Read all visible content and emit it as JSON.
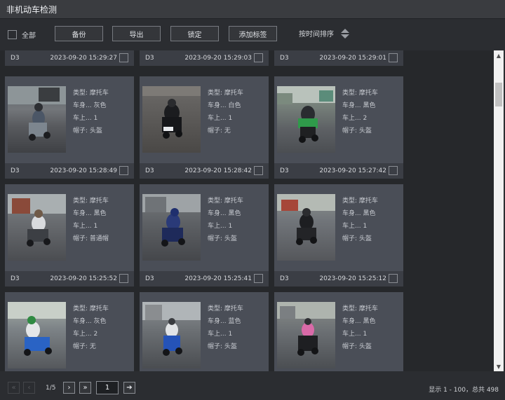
{
  "window": {
    "title": "非机动车检测"
  },
  "toolbar": {
    "select_all_label": "全部",
    "backup_label": "备份",
    "export_label": "导出",
    "lock_label": "锁定",
    "add_tag_label": "添加标签",
    "sort_label": "按时间排序"
  },
  "attr_labels": {
    "type": "类型:",
    "body": "车身...",
    "riders": "车上...",
    "helmet": "帽子:"
  },
  "top_row": [
    {
      "camera": "D3",
      "time": "2023-09-20 15:29:27"
    },
    {
      "camera": "D3",
      "time": "2023-09-20 15:29:03"
    },
    {
      "camera": "D3",
      "time": "2023-09-20 15:29:01"
    }
  ],
  "cards": [
    {
      "type": "摩托车",
      "body_color": "灰色",
      "riders": "1",
      "helmet": "头盔",
      "camera": "D3",
      "time": "2023-09-20 15:28:49"
    },
    {
      "type": "摩托车",
      "body_color": "白色",
      "riders": "1",
      "helmet": "无",
      "camera": "D3",
      "time": "2023-09-20 15:28:42"
    },
    {
      "type": "摩托车",
      "body_color": "黑色",
      "riders": "2",
      "helmet": "头盔",
      "camera": "D3",
      "time": "2023-09-20 15:27:42"
    },
    {
      "type": "摩托车",
      "body_color": "黑色",
      "riders": "1",
      "helmet": "普通帽",
      "camera": "D3",
      "time": "2023-09-20 15:25:52"
    },
    {
      "type": "摩托车",
      "body_color": "黑色",
      "riders": "1",
      "helmet": "头盔",
      "camera": "D3",
      "time": "2023-09-20 15:25:41"
    },
    {
      "type": "摩托车",
      "body_color": "黑色",
      "riders": "1",
      "helmet": "头盔",
      "camera": "D3",
      "time": "2023-09-20 15:25:12"
    },
    {
      "type": "摩托车",
      "body_color": "灰色",
      "riders": "2",
      "helmet": "无",
      "camera": "",
      "time": ""
    },
    {
      "type": "摩托车",
      "body_color": "蓝色",
      "riders": "1",
      "helmet": "头盔",
      "camera": "",
      "time": ""
    },
    {
      "type": "摩托车",
      "body_color": "黑色",
      "riders": "1",
      "helmet": "头盔",
      "camera": "",
      "time": ""
    }
  ],
  "pager": {
    "first_icon": "«",
    "prev_icon": "‹",
    "page_indicator": "1/5",
    "next_icon": "›",
    "last_icon": "»",
    "page_input_value": "1",
    "go_icon": "➔",
    "summary": "显示 1 - 100，总共 498"
  },
  "scrollbar": {
    "up_icon": "▲",
    "down_icon": "▼"
  },
  "colors": {
    "card_bg": "#4a4e57",
    "footer_bg": "#3b3e45",
    "window_bg": "#2b2d31"
  }
}
